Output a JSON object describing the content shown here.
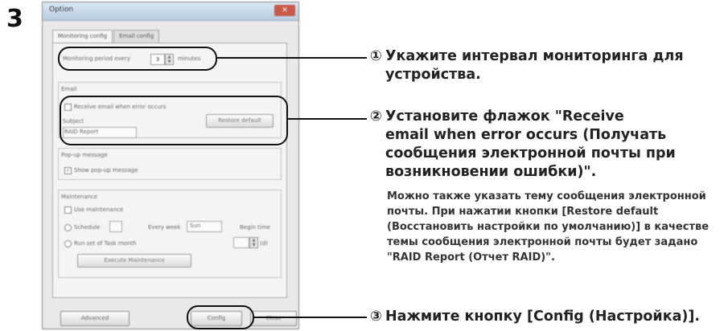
{
  "step_number": "3",
  "dialog": {
    "title": "Option",
    "close_label": "✕",
    "tabs": [
      "Monitoring config",
      "Email config"
    ],
    "monitoring": {
      "label": "Monitoring period every",
      "value": "3",
      "unit": "minutes"
    },
    "email": {
      "group_label": "Email",
      "checkbox_label": "Receive email when error occurs",
      "subject_label": "Subject",
      "restore_button": "Restore default",
      "subject_value": "RAID Report"
    },
    "popup": {
      "group_label": "Pop-up message",
      "checkbox_label": "Show pop-up message"
    },
    "maintenance": {
      "group_label": "Maintenance",
      "checkbox_label": "Use maintenance",
      "radio1_label": "Schedule",
      "radio1_mid": "Every week",
      "radio1_unit": "Sun",
      "radio1_end": "Begin time",
      "radio2_label": "Run set of Task month",
      "radio2_unit": "(d)",
      "action_button": "Execute Maintenance"
    },
    "buttons": {
      "advanced": "Advanced",
      "config": "Config",
      "close": "Close"
    }
  },
  "instructions": {
    "item1": {
      "num": "①",
      "lines": [
        "Укажите интервал мониторинга для",
        "устройства."
      ]
    },
    "item2": {
      "num": "②",
      "lines": [
        "Установите флажок \"Receive",
        "email when error occurs (Получать",
        "сообщения электронной почты при",
        "возникновении ошибки)\"."
      ]
    },
    "note": "Можно также указать тему сообщения электронной почты.  При нажатии кнопки [Restore default (Восстановить настройки по умолчанию)] в качестве темы сообщения электронной почты будет задано \"RAID Report (Отчет RAID)\".",
    "item3": {
      "num": "③",
      "lines": [
        "Нажмите кнопку [Config (Настройка)]."
      ]
    }
  }
}
